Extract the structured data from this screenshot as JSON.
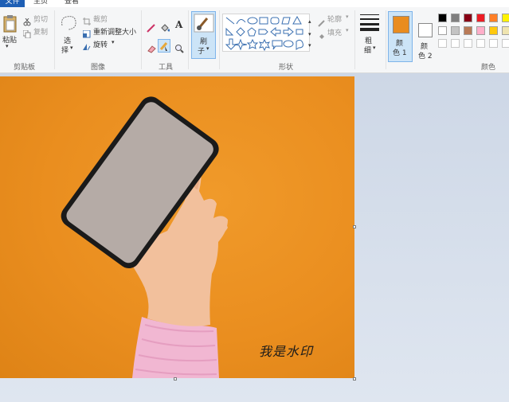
{
  "tabs": {
    "file": "文件",
    "home": "主页",
    "view": "查看"
  },
  "clipboard": {
    "paste": "粘贴",
    "cut": "剪切",
    "copy": "复制",
    "group": "剪贴板"
  },
  "image": {
    "select": "选",
    "select2": "择",
    "crop": "裁剪",
    "resize": "重新调整大小",
    "rotate": "旋转",
    "group": "图像"
  },
  "tools": {
    "group": "工具"
  },
  "brush": {
    "label": "刷",
    "label2": "子"
  },
  "shapes": {
    "outline": "轮廓",
    "fill": "填充",
    "group": "形状"
  },
  "size": {
    "label": "粗",
    "label2": "细"
  },
  "colors": {
    "color1": "颜",
    "color1b": "色 1",
    "color2": "颜",
    "color2b": "色 2",
    "group": "颜色",
    "color1_value": "#e98c1f",
    "palette_row1": [
      "#000000",
      "#7f7f7f",
      "#880015",
      "#ed1c24",
      "#ff7f27",
      "#fff200"
    ],
    "palette_row2": [
      "#ffffff",
      "#c3c3c3",
      "#b97a57",
      "#ffaec9",
      "#ffc90e",
      "#efe4b0"
    ]
  },
  "canvas": {
    "watermark": "我是水印",
    "background": "#e98c1f"
  }
}
